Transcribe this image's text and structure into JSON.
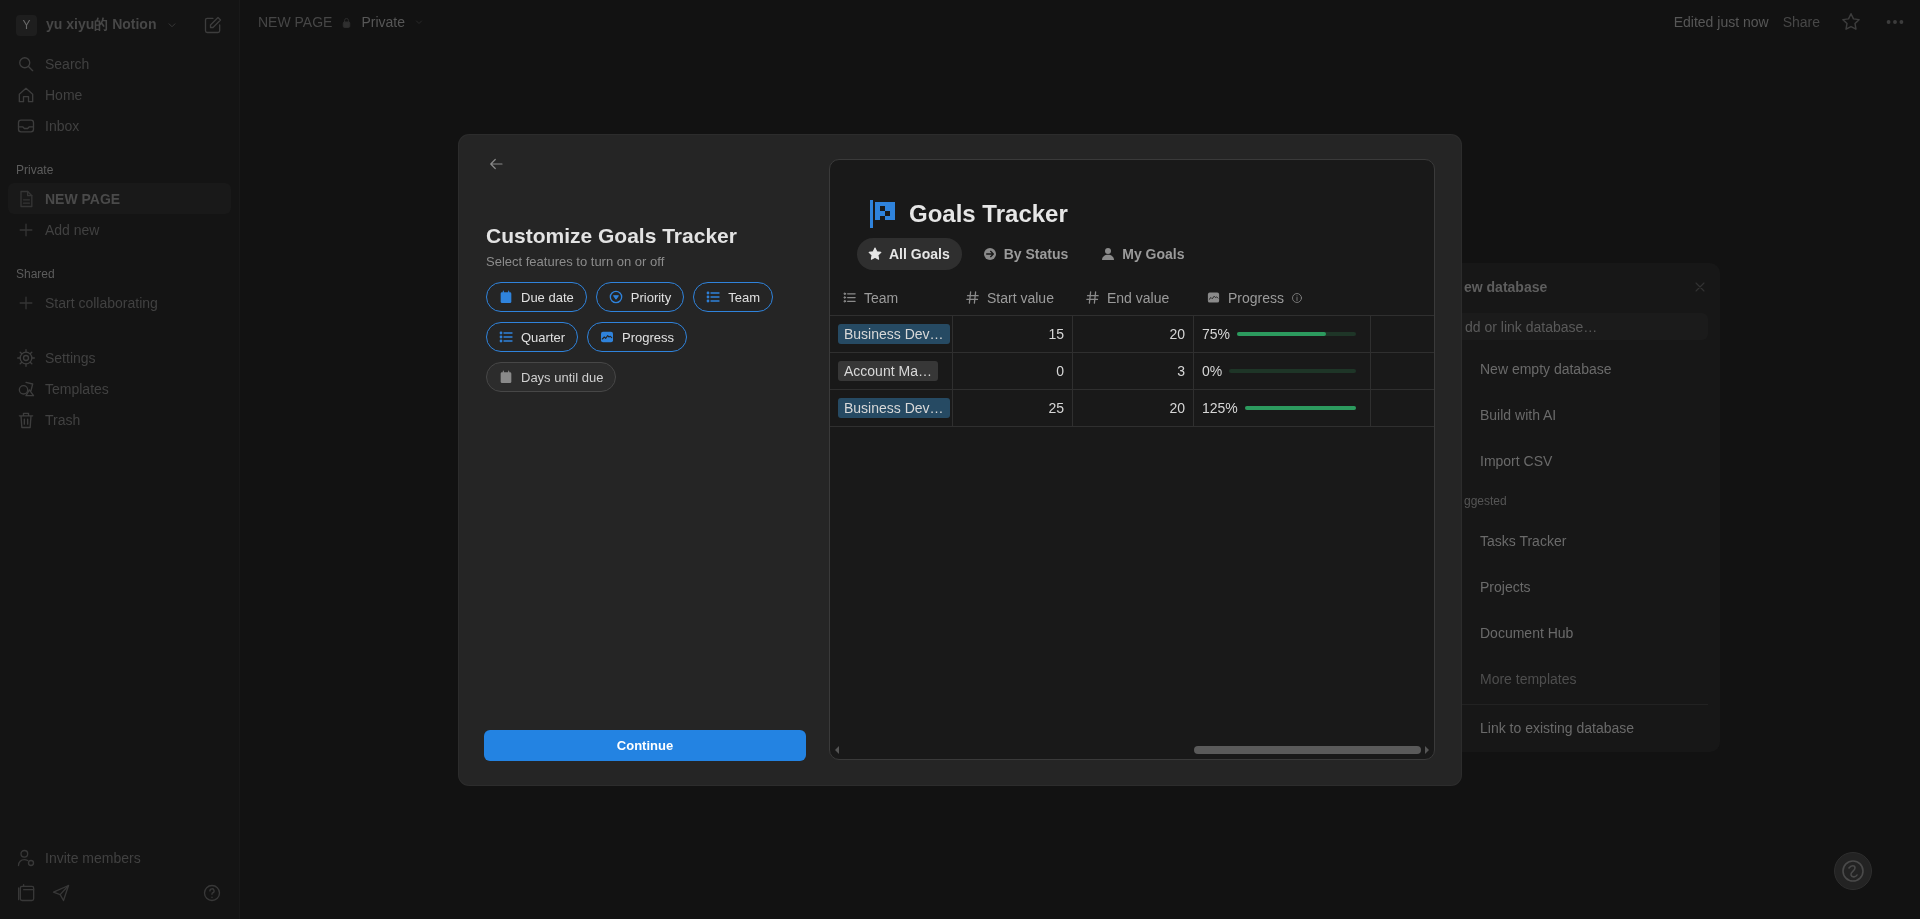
{
  "sidebar": {
    "workspace": {
      "avatar": "Y",
      "name": "yu xiyu的 Notion"
    },
    "nav": [
      {
        "label": "Search"
      },
      {
        "label": "Home"
      },
      {
        "label": "Inbox"
      }
    ],
    "sections": [
      {
        "title": "Private",
        "items": [
          {
            "label": "NEW PAGE",
            "selected": true
          },
          {
            "label": "Add new",
            "selected": false
          }
        ]
      },
      {
        "title": "Shared",
        "items": [
          {
            "label": "Start collaborating",
            "selected": false
          }
        ]
      }
    ],
    "utility": [
      {
        "label": "Settings"
      },
      {
        "label": "Templates"
      },
      {
        "label": "Trash"
      }
    ],
    "invite": "Invite members"
  },
  "topbar": {
    "breadcrumb": "NEW PAGE",
    "privacy": "Private",
    "edited": "Edited just now",
    "share": "Share"
  },
  "modal": {
    "title": "Customize Goals Tracker",
    "subtitle": "Select features to turn on or off",
    "features": [
      {
        "label": "Due date",
        "selected": true
      },
      {
        "label": "Priority",
        "selected": true
      },
      {
        "label": "Team",
        "selected": true
      },
      {
        "label": "Quarter",
        "selected": true
      },
      {
        "label": "Progress",
        "selected": true
      },
      {
        "label": "Days until due",
        "selected": false
      }
    ],
    "continue": "Continue",
    "preview": {
      "title": "Goals Tracker",
      "views": [
        {
          "label": "All Goals",
          "selected": true
        },
        {
          "label": "By Status",
          "selected": false
        },
        {
          "label": "My Goals",
          "selected": false
        }
      ],
      "columns": [
        {
          "label": "Team"
        },
        {
          "label": "Start value"
        },
        {
          "label": "End value"
        },
        {
          "label": "Progress"
        }
      ],
      "rows": [
        {
          "team": {
            "label": "Business Dev…",
            "color": "#264a63"
          },
          "start": "15",
          "end": "20",
          "progress": {
            "reading": "75%",
            "level": 0.75
          }
        },
        {
          "team": {
            "label": "Account Ma…",
            "color": "#373737"
          },
          "start": "0",
          "end": "3",
          "progress": {
            "reading": "0%",
            "level": 0
          }
        },
        {
          "team": {
            "label": "Business Dev…",
            "color": "#264a63"
          },
          "start": "25",
          "end": "20",
          "progress": {
            "reading": "125%",
            "level": 1
          }
        }
      ]
    }
  },
  "new_database_panel": {
    "title": "ew database",
    "search": {
      "placeholder": "dd or link database…"
    },
    "actions": [
      {
        "label": "New empty database"
      },
      {
        "label": "Build with AI"
      },
      {
        "label": "Import CSV"
      }
    ],
    "section": "ggested",
    "templates": [
      {
        "label": "Tasks Tracker",
        "disabled": false
      },
      {
        "label": "Projects",
        "disabled": false
      },
      {
        "label": "Document Hub",
        "disabled": false
      },
      {
        "label": "More templates",
        "disabled": true
      }
    ],
    "link": "Link to existing database"
  }
}
